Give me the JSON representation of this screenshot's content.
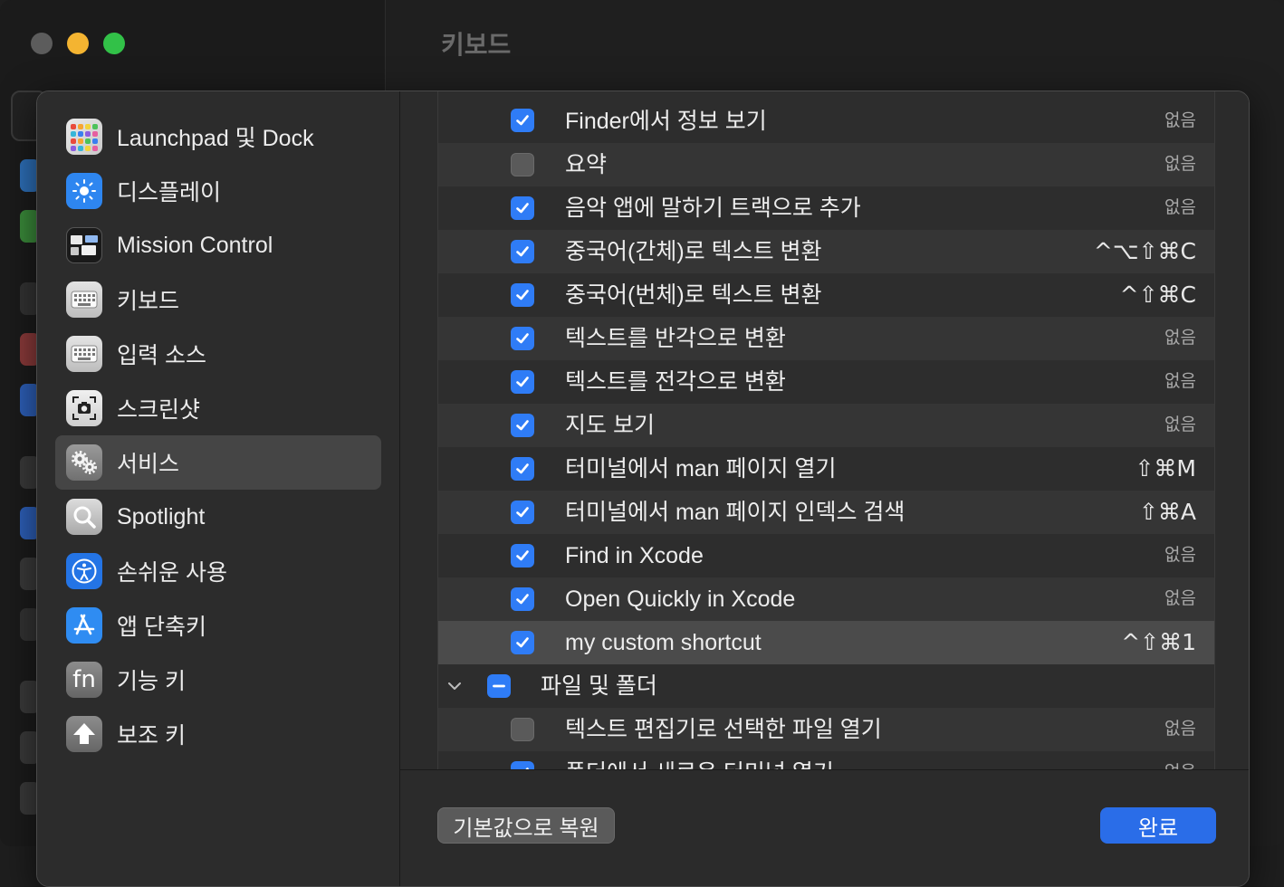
{
  "window": {
    "title": "키보드"
  },
  "sidebar": {
    "items": [
      {
        "label": "Launchpad 및 Dock",
        "icon": "launchpad-icon"
      },
      {
        "label": "디스플레이",
        "icon": "display-brightness-icon"
      },
      {
        "label": "Mission Control",
        "icon": "mission-control-icon"
      },
      {
        "label": "키보드",
        "icon": "keyboard-icon"
      },
      {
        "label": "입력 소스",
        "icon": "input-sources-icon"
      },
      {
        "label": "스크린샷",
        "icon": "screenshot-icon"
      },
      {
        "label": "서비스",
        "icon": "gears-icon",
        "selected": true
      },
      {
        "label": "Spotlight",
        "icon": "spotlight-icon"
      },
      {
        "label": "손쉬운 사용",
        "icon": "accessibility-icon"
      },
      {
        "label": "앱 단축키",
        "icon": "app-shortcuts-icon"
      },
      {
        "label": "기능 키",
        "icon": "fn-key-icon",
        "icon_text": "fn"
      },
      {
        "label": "보조 키",
        "icon": "modifier-keys-icon"
      }
    ]
  },
  "shortcuts": {
    "rows": [
      {
        "label": "Finder에서 정보 보기",
        "checked": true,
        "key": "없음"
      },
      {
        "label": "요약",
        "checked": false,
        "key": "없음"
      },
      {
        "label": "음악 앱에 말하기 트랙으로 추가",
        "checked": true,
        "key": "없음"
      },
      {
        "label": "중국어(간체)로 텍스트 변환",
        "checked": true,
        "key": "^⌥⇧⌘C"
      },
      {
        "label": "중국어(번체)로 텍스트 변환",
        "checked": true,
        "key": "^⇧⌘C"
      },
      {
        "label": "텍스트를 반각으로 변환",
        "checked": true,
        "key": "없음"
      },
      {
        "label": "텍스트를 전각으로 변환",
        "checked": true,
        "key": "없음"
      },
      {
        "label": "지도 보기",
        "checked": true,
        "key": "없음"
      },
      {
        "label": "터미널에서 man 페이지 열기",
        "checked": true,
        "key": "⇧⌘M"
      },
      {
        "label": "터미널에서 man 페이지 인덱스 검색",
        "checked": true,
        "key": "⇧⌘A"
      },
      {
        "label": "Find in Xcode",
        "checked": true,
        "key": "없음"
      },
      {
        "label": "Open Quickly in Xcode",
        "checked": true,
        "key": "없음"
      },
      {
        "label": "my custom shortcut",
        "checked": true,
        "key": "^⇧⌘1",
        "selected": true
      }
    ],
    "group": {
      "label": "파일 및 폴더",
      "state": "mixed",
      "expanded": true
    },
    "group_rows": [
      {
        "label": "텍스트 편집기로 선택한 파일 열기",
        "checked": false,
        "key": "없음"
      },
      {
        "label": "폴더에서 새로운 터미널 열기",
        "checked": true,
        "key": "없음"
      }
    ]
  },
  "footer": {
    "restore_label": "기본값으로 복원",
    "done_label": "완료"
  },
  "colors": {
    "accent": "#2f7cf6",
    "done_button": "#2a6de8",
    "traffic_close": "#5c5c5c",
    "traffic_min": "#f4b431",
    "traffic_max": "#32c148"
  }
}
